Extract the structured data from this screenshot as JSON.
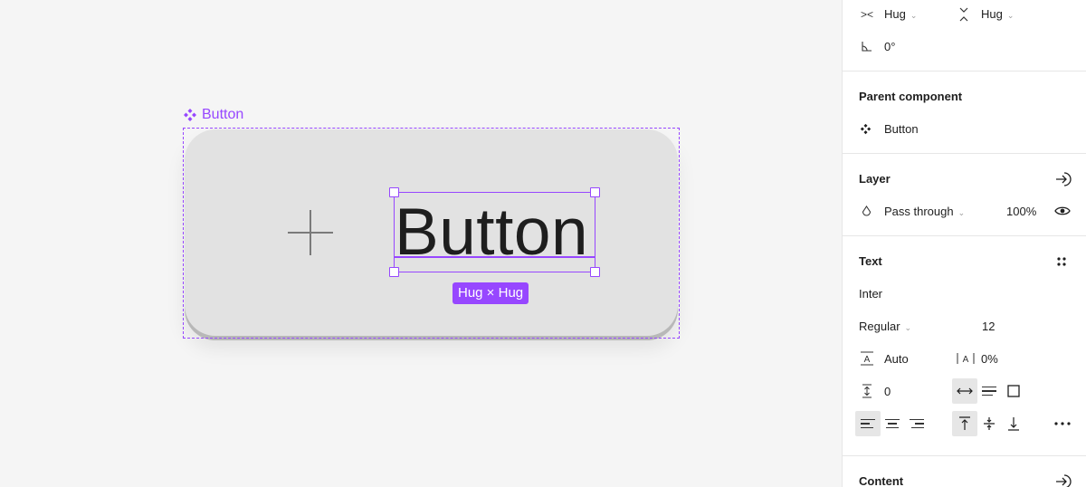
{
  "canvas": {
    "component_label": "Button",
    "button_text": "Button",
    "size_badge": "Hug × Hug"
  },
  "colors": {
    "selection": "#9747ff",
    "canvas_bg": "#f5f5f5",
    "button_fill": "#e2e2e2"
  },
  "panel": {
    "layout": {
      "width_mode": "Hug",
      "height_mode": "Hug",
      "rotation": "0°"
    },
    "parent_component": {
      "title": "Parent component",
      "name": "Button"
    },
    "layer": {
      "title": "Layer",
      "blend_mode": "Pass through",
      "opacity": "100%"
    },
    "text": {
      "title": "Text",
      "font_family": "Inter",
      "font_weight": "Regular",
      "font_size": "12",
      "line_height": "Auto",
      "letter_spacing": "0%",
      "paragraph_spacing": "0"
    },
    "content": {
      "title": "Content"
    }
  }
}
